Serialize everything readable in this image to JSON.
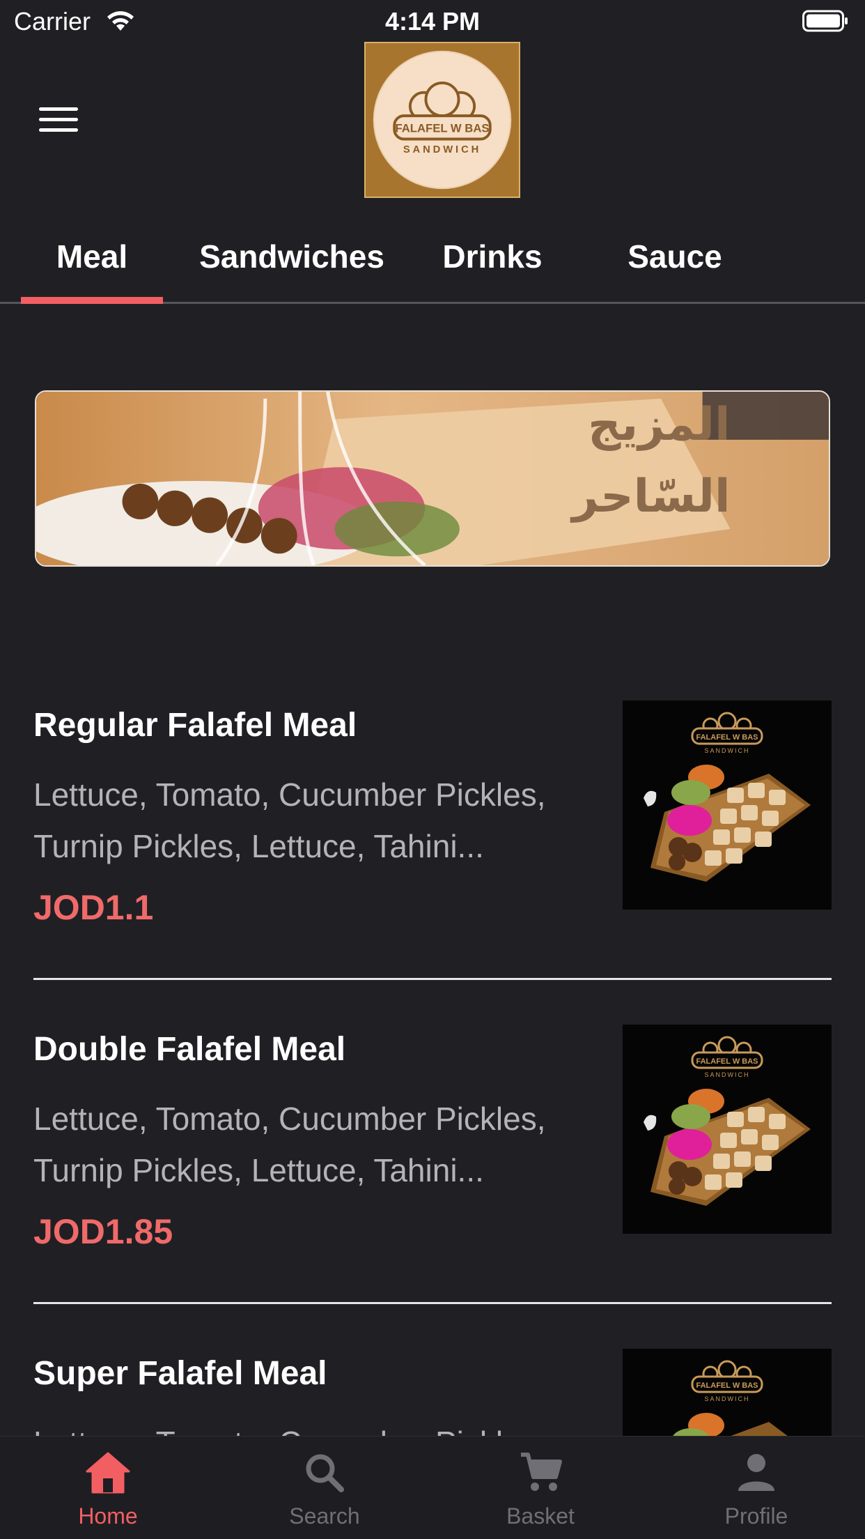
{
  "status_bar": {
    "carrier": "Carrier",
    "time": "4:14 PM"
  },
  "header": {
    "menu_icon": "hamburger-menu-icon",
    "logo_text_line1": "FALAFEL W BAS",
    "logo_text_line2": "SANDWICH"
  },
  "tabs": [
    {
      "label": "Meal",
      "active": true
    },
    {
      "label": "Sandwiches",
      "active": false
    },
    {
      "label": "Drinks",
      "active": false
    },
    {
      "label": "Sauce",
      "active": false
    }
  ],
  "banner": {
    "text_line1": "المزيج",
    "text_line2": "السّاحر"
  },
  "menu_items": [
    {
      "title": "Regular Falafel Meal",
      "description": "Lettuce, Tomato, Cucumber Pickles, Turnip Pickles, Lettuce, Tahini...",
      "price": "JOD1.1",
      "thumb_logo_line1": "FALAFEL W BAS",
      "thumb_logo_line2": "SANDWICH"
    },
    {
      "title": "Double Falafel Meal",
      "description": "Lettuce, Tomato, Cucumber Pickles, Turnip Pickles, Lettuce, Tahini...",
      "price": "JOD1.85",
      "thumb_logo_line1": "FALAFEL W BAS",
      "thumb_logo_line2": "SANDWICH"
    },
    {
      "title": "Super Falafel Meal",
      "description": "Lettuce, Tomato, Cucumber Pickles",
      "price": "",
      "thumb_logo_line1": "FALAFEL W BAS",
      "thumb_logo_line2": "SANDWICH"
    }
  ],
  "bottom_nav": [
    {
      "label": "Home",
      "icon": "home-icon",
      "active": true
    },
    {
      "label": "Search",
      "icon": "search-icon",
      "active": false
    },
    {
      "label": "Basket",
      "icon": "cart-icon",
      "active": false
    },
    {
      "label": "Profile",
      "icon": "profile-icon",
      "active": false
    }
  ],
  "colors": {
    "background": "#202024",
    "accent": "#f25f63",
    "price": "#f06a6a",
    "inactive_nav": "#6f6f75"
  }
}
